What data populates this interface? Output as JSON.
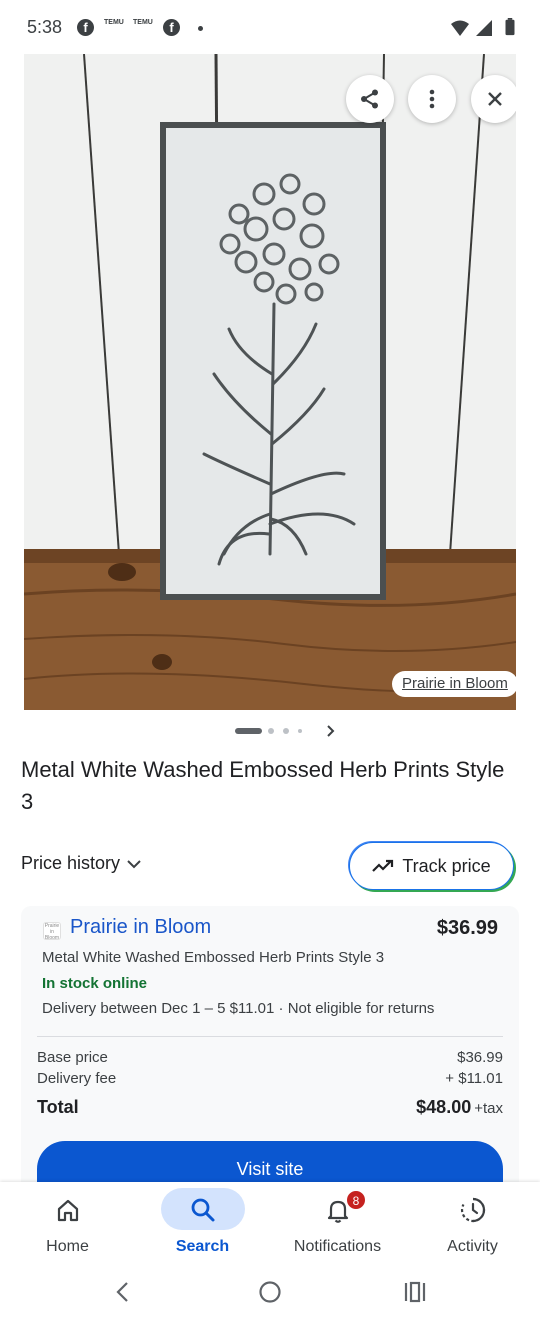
{
  "status_bar": {
    "time": "5:38",
    "notif_icons": [
      "facebook-icon",
      "temu-icon",
      "temu-icon",
      "facebook-icon",
      "dot-icon"
    ],
    "temu_text": "TEMU"
  },
  "hero": {
    "source_label": "Prairie in Bloom",
    "buttons": [
      "share-icon",
      "more-vert-icon",
      "close-icon"
    ]
  },
  "pager": {
    "count": 4,
    "active_index": 0
  },
  "product": {
    "title": "Metal White Washed Embossed Herb Prints Style 3"
  },
  "price_history": {
    "label": "Price history"
  },
  "track_price": {
    "label": "Track price"
  },
  "offer": {
    "store_name": "Prairie in Bloom",
    "store_logo_text": "Prairie in Bloom",
    "price": "$36.99",
    "description": "Metal White Washed Embossed Herb Prints Style 3",
    "stock": "In stock online",
    "delivery": "Delivery between Dec 1 – 5 $11.01 · Not eligible for returns",
    "base_price_label": "Base price",
    "base_price_value": "$36.99",
    "delivery_fee_label": "Delivery fee",
    "delivery_fee_value": "+ $11.01",
    "total_label": "Total",
    "total_value": "$48.00",
    "total_tax": "+tax",
    "visit_label": "Visit site"
  },
  "bottom_nav": {
    "items": [
      {
        "label": "Home",
        "icon": "home-icon"
      },
      {
        "label": "Search",
        "icon": "search-icon",
        "active": true
      },
      {
        "label": "Notifications",
        "icon": "bell-icon",
        "badge": "8"
      },
      {
        "label": "Activity",
        "icon": "activity-icon"
      }
    ]
  },
  "colors": {
    "accent": "#0b57d0",
    "store_link": "#1a56c9",
    "in_stock": "#137333",
    "badge": "#c5221f",
    "nav_pill": "#d3e3fd"
  }
}
